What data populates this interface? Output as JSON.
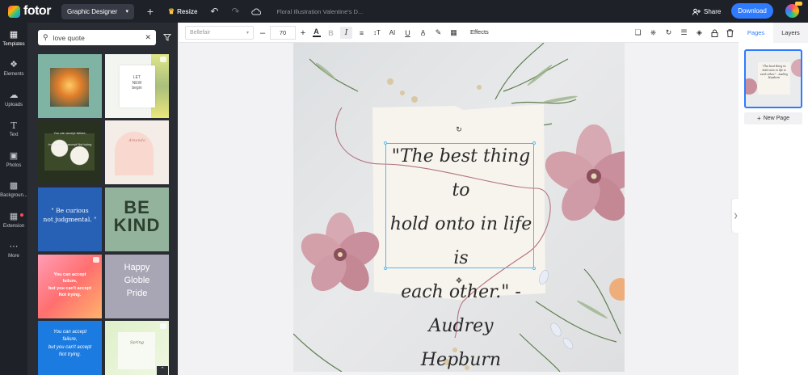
{
  "app": {
    "logo_text": "fotor"
  },
  "topbar": {
    "mode": "Graphic Designer",
    "resize_label": "Resize",
    "doc_title": "Floral Illustration Valentine's D...",
    "share_label": "Share",
    "download_label": "Download"
  },
  "rail": [
    {
      "label": "Templates",
      "icon": "templates-icon"
    },
    {
      "label": "Elements",
      "icon": "elements-icon"
    },
    {
      "label": "Uploads",
      "icon": "uploads-icon"
    },
    {
      "label": "Text",
      "icon": "text-icon"
    },
    {
      "label": "Photos",
      "icon": "photos-icon"
    },
    {
      "label": "Backgroun...",
      "icon": "background-icon"
    },
    {
      "label": "Extension",
      "icon": "extension-icon"
    },
    {
      "label": "More",
      "icon": "more-icon"
    }
  ],
  "search": {
    "value": "love quote"
  },
  "templates": [
    {
      "text": "",
      "bg": "#7fb4a4"
    },
    {
      "text": "LET\nNEW\nbegin",
      "bg": "#f3f5f1"
    },
    {
      "text": "You can accept failure,\nbut you can't accept Not trying",
      "bg": "#28301f"
    },
    {
      "text": "Amanda",
      "bg": "#f4ece6"
    },
    {
      "text": "\" Be curious\nnot judgmental. \"",
      "bg": "#2761b5"
    },
    {
      "text": "BE\nKIND",
      "bg": "#93b39c"
    },
    {
      "text": "You can accept\nfailure,\nbut you can't accept\nNot trying.",
      "bg": "#ff6f6f"
    },
    {
      "text": "Happy\nGloble\nPride",
      "bg": "#a8a6b5"
    },
    {
      "text": "You can accept\nfailure,\nbut you can't accept\nNot trying.",
      "bg": "#1b7be0"
    },
    {
      "text": "Spring",
      "bg": "#dff0c9"
    }
  ],
  "format_toolbar": {
    "font_name": "Bellefair",
    "font_size": "70",
    "effects_label": "Effects"
  },
  "right_panel": {
    "tabs": [
      "Pages",
      "Layers"
    ],
    "new_page_label": "New Page"
  },
  "canvas": {
    "quote_line1": "\"The best thing to",
    "quote_line2": "hold onto in life is",
    "quote_line3": "each other.\" -",
    "quote_line4": "Audrey Hepburn",
    "thumb_text": "\"The best thing to hold onto in life is each other.\" - Audrey Hepburn"
  },
  "colors": {
    "accent": "#2f7bff",
    "topbar_bg": "#1f2129",
    "panel_bg": "#2a2c34",
    "paper": "#f7f4ee",
    "flower": "#c98f9d"
  }
}
